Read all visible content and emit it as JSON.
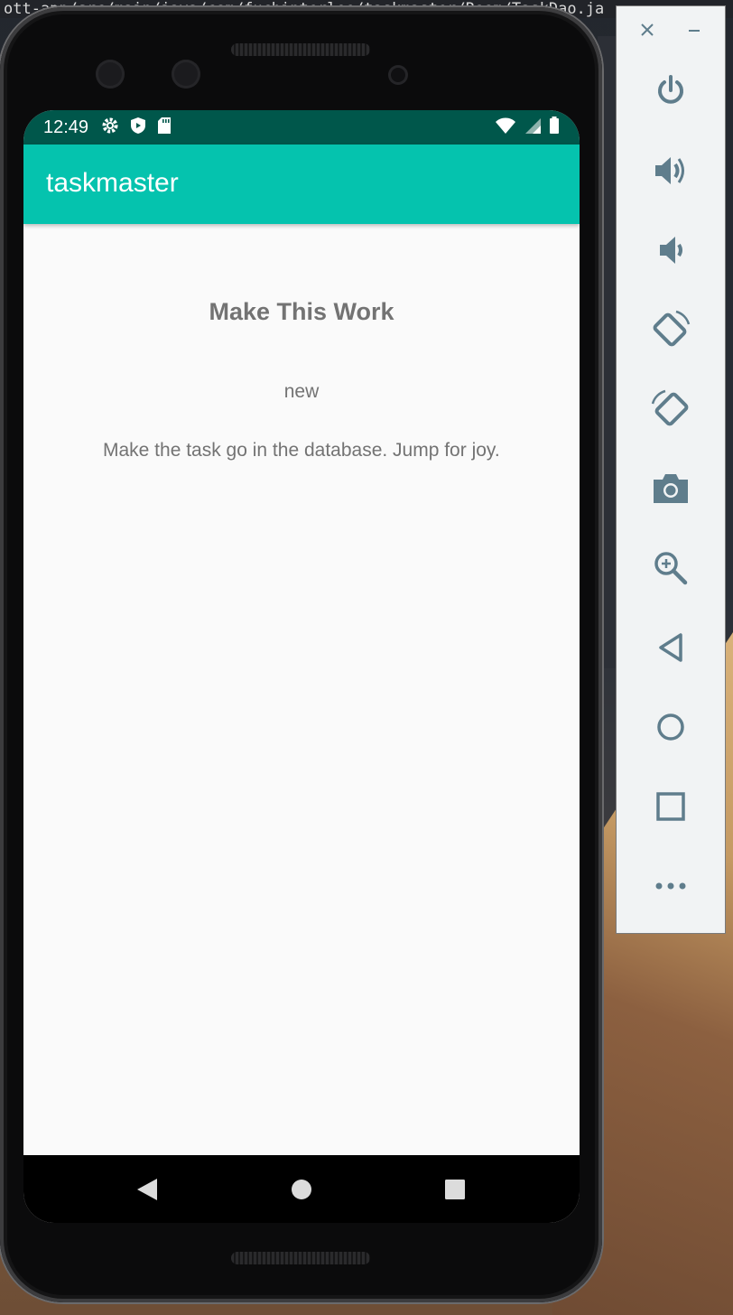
{
  "backdrop": {
    "code_line": "ott-app/src/main/java/com/fuchinterlee/taskmaster/Room/TaskDao.ja"
  },
  "status_bar": {
    "time": "12:49",
    "icons_left": [
      "settings-icon",
      "shield-icon",
      "sd-card-icon"
    ],
    "icons_right": [
      "wifi-icon",
      "cellular-icon",
      "battery-icon"
    ]
  },
  "app_bar": {
    "title": "taskmaster",
    "color": "#05c3ae"
  },
  "task": {
    "title": "Make This Work",
    "state": "new",
    "body": "Make the task go in the database. Jump for joy."
  },
  "nav_bar": {
    "buttons": [
      "back-icon",
      "home-icon",
      "recents-icon"
    ]
  },
  "emulator_panel": {
    "window_controls": [
      "close-icon",
      "minimize-icon"
    ],
    "buttons": [
      {
        "name": "power",
        "icon": "power-icon"
      },
      {
        "name": "volume-up",
        "icon": "volume-up-icon"
      },
      {
        "name": "volume-down",
        "icon": "volume-down-icon"
      },
      {
        "name": "rotate-left",
        "icon": "rotate-left-icon"
      },
      {
        "name": "rotate-right",
        "icon": "rotate-right-icon"
      },
      {
        "name": "screenshot",
        "icon": "camera-icon"
      },
      {
        "name": "zoom",
        "icon": "zoom-in-icon"
      },
      {
        "name": "back",
        "icon": "back-icon"
      },
      {
        "name": "home",
        "icon": "home-icon"
      },
      {
        "name": "overview",
        "icon": "overview-icon"
      },
      {
        "name": "more",
        "icon": "more-icon"
      }
    ],
    "icon_color": "#5f7d8c"
  }
}
